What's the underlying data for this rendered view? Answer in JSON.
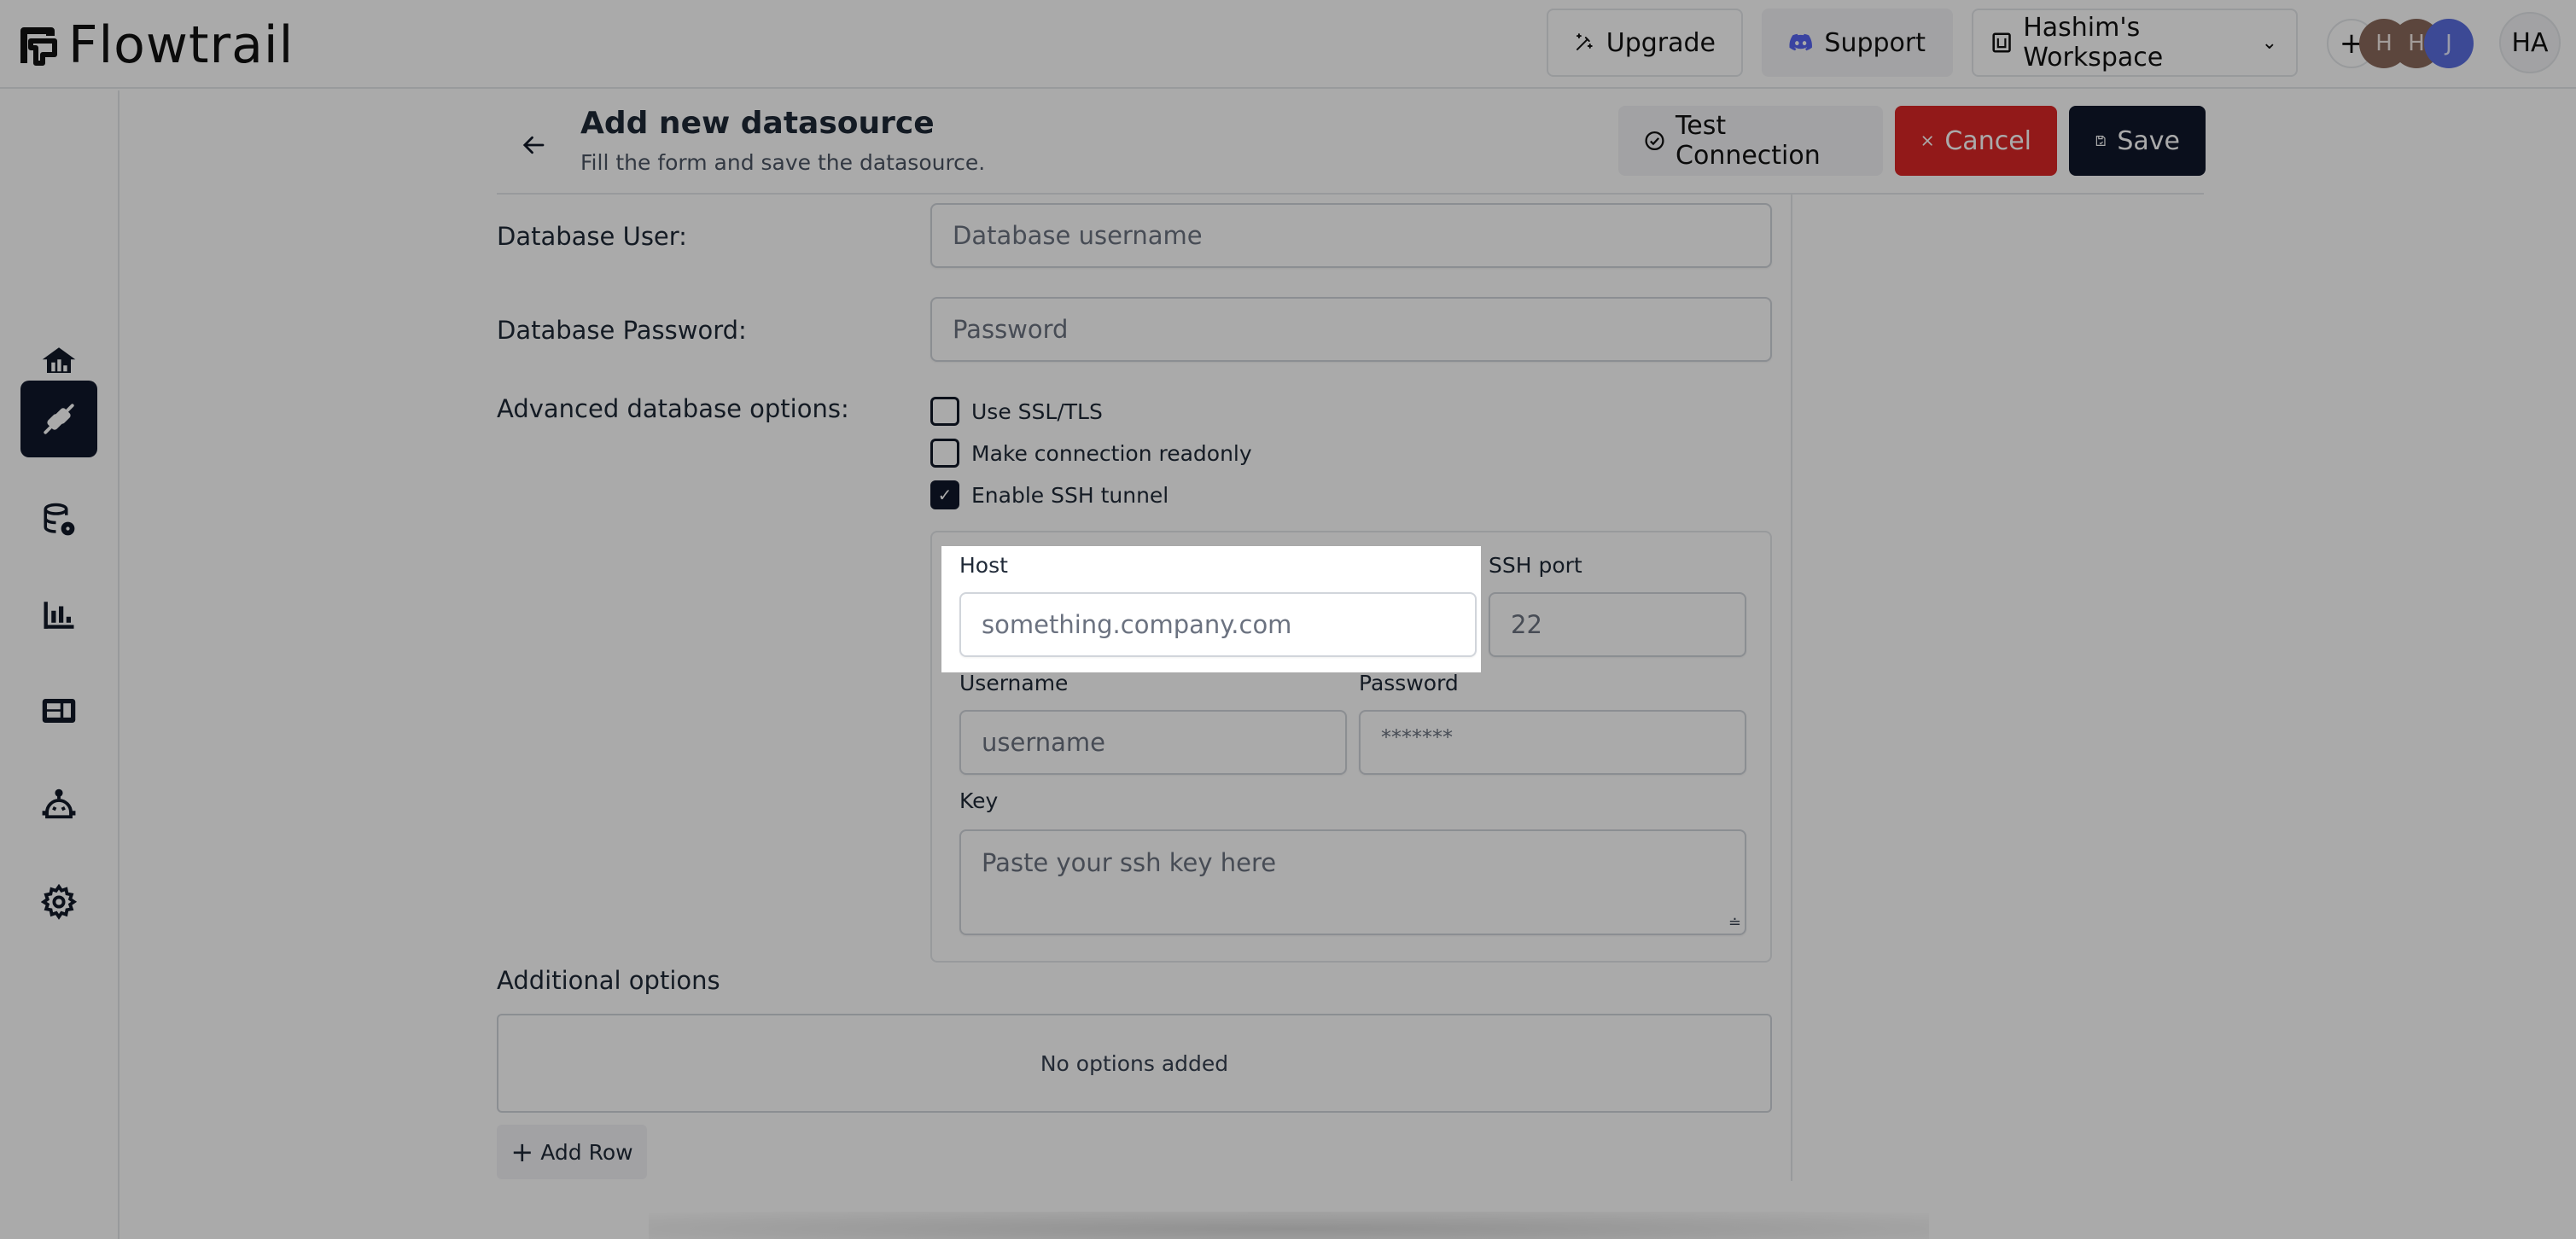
{
  "app": {
    "name": "Flowtrail",
    "logo_icon": "flowtrail-logo-icon"
  },
  "topbar": {
    "upgrade_label": "Upgrade",
    "upgrade_icon": "magic-wand-icon",
    "support_label": "Support",
    "support_icon": "discord-icon",
    "workspace_label": "Hashim's Workspace",
    "workspace_icon": "workspace-icon",
    "workspace_chevron": "chevron-down-icon",
    "add_member_label": "+",
    "members": [
      {
        "initial": "H",
        "color": "#8b6a5c"
      },
      {
        "initial": "H",
        "color": "#8b6a5c"
      },
      {
        "initial": "J",
        "color": "#5a6ee0"
      }
    ],
    "user_initials": "HA"
  },
  "sidebar": {
    "items": [
      {
        "name": "home",
        "icon": "home-icon",
        "active": false
      },
      {
        "name": "datasources",
        "icon": "plug-icon",
        "active": true
      },
      {
        "name": "database-settings",
        "icon": "database-gear-icon",
        "active": false
      },
      {
        "name": "charts",
        "icon": "bar-chart-icon",
        "active": false
      },
      {
        "name": "dashboards",
        "icon": "dashboard-icon",
        "active": false
      },
      {
        "name": "ai-assistant",
        "icon": "robot-icon",
        "active": false
      },
      {
        "name": "settings",
        "icon": "gear-icon",
        "active": false
      }
    ]
  },
  "header": {
    "title": "Add new datasource",
    "subtitle": "Fill the form and save the datasource.",
    "test_connection_label": "Test Connection",
    "cancel_label": "Cancel",
    "save_label": "Save"
  },
  "form": {
    "db_user": {
      "label": "Database User:",
      "placeholder": "Database username",
      "value": ""
    },
    "db_password": {
      "label": "Database Password:",
      "placeholder": "Password",
      "value": ""
    },
    "advanced": {
      "label": "Advanced database options:",
      "options": [
        {
          "label": "Use SSL/TLS",
          "checked": false
        },
        {
          "label": "Make connection readonly",
          "checked": false
        },
        {
          "label": "Enable SSH tunnel",
          "checked": true
        }
      ]
    },
    "ssh": {
      "host": {
        "label": "Host",
        "placeholder": "something.company.com"
      },
      "port": {
        "label": "SSH port",
        "placeholder": "22"
      },
      "username": {
        "label": "Username",
        "placeholder": "username"
      },
      "password": {
        "label": "Password",
        "placeholder": "*******"
      },
      "key": {
        "label": "Key",
        "placeholder": "Paste your ssh key here"
      }
    },
    "additional_options": {
      "label": "Additional options",
      "empty_text": "No options added",
      "add_row_label": "Add Row"
    }
  },
  "colors": {
    "accent_dark": "#0f172a",
    "danger": "#dc2626",
    "discord": "#5865f2"
  }
}
